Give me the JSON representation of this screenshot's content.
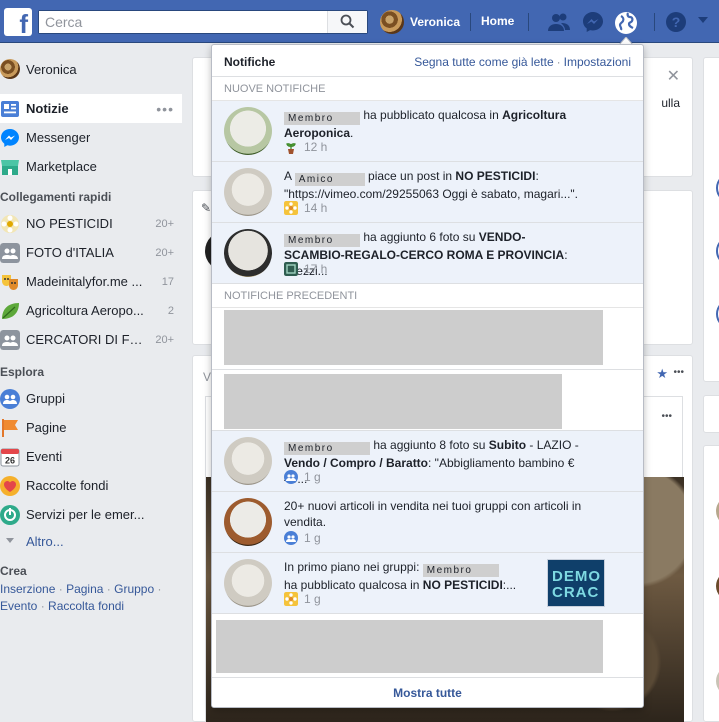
{
  "topbar": {
    "logo": "f",
    "search_placeholder": "Cerca",
    "user_name": "Veronica",
    "home_label": "Home"
  },
  "leftnav": {
    "user": "Veronica",
    "items": [
      {
        "label": "Notizie"
      },
      {
        "label": "Messenger"
      },
      {
        "label": "Marketplace"
      }
    ],
    "shortcuts_header": "Collegamenti rapidi",
    "shortcuts": [
      {
        "label": "NO PESTICIDI",
        "count": "20+"
      },
      {
        "label": "FOTO d'ITALIA",
        "count": "20+"
      },
      {
        "label": "Madeinitalyfor.me ...",
        "count": "17"
      },
      {
        "label": "Agricoltura Aeropo...",
        "count": "2"
      },
      {
        "label": "CERCATORI DI FU...",
        "count": "20+"
      }
    ],
    "explore_header": "Esplora",
    "explore": [
      {
        "label": "Gruppi"
      },
      {
        "label": "Pagine"
      },
      {
        "label": "Eventi"
      },
      {
        "label": "Raccolte fondi"
      },
      {
        "label": "Servizi per le emer..."
      }
    ],
    "more": "Altro...",
    "create_header": "Crea",
    "create_links": [
      "Inserzione",
      "Pagina",
      "Gruppo",
      "Evento",
      "Raccolta fondi"
    ],
    "sep": "·"
  },
  "feed": {
    "partial_text": "ulla",
    "partial_v": "V"
  },
  "notifications": {
    "title": "Notifiche",
    "mark_all": "Segna tutte come già lette",
    "settings": "Impostazioni",
    "new_section": "NUOVE NOTIFICHE",
    "old_section": "NOTIFICHE PRECEDENTI",
    "items": [
      {
        "tag": "Membro",
        "pre": "",
        "text": " ha pubblicato qualcosa in ",
        "strong": "Agricoltura Aeroponica",
        "tail": ".",
        "time": "12 h"
      },
      {
        "tag": "Amico",
        "pre": "A ",
        "text": " piace un post in ",
        "strong": "NO PESTICIDI",
        "tail": ": \"https://vimeo.com/29255063 Oggi è sabato, magari...\".",
        "time": "14 h"
      },
      {
        "tag": "Membro",
        "pre": "",
        "text": " ha aggiunto 6 foto su ",
        "strong": "VENDO-SCAMBIO-REGALO-CERCO ROMA E PROVINCIA",
        "tail": ": \"Pezzi...",
        "time": "17 h"
      },
      {
        "tag": "Membro",
        "pre": "",
        "text": " ha aggiunto 8 foto su ",
        "strong": "Subito",
        "tail": " - LAZIO - ",
        "strong2": "Vendo / Compro / Baratto",
        "tail2": ": \"Abbigliamento bambino € 40...",
        "time": "1 g"
      },
      {
        "text": "20+ nuovi articoli in vendita nei tuoi gruppi con articoli in vendita.",
        "time": "1 g"
      },
      {
        "tag": "Membro",
        "pre": "In primo piano nei gruppi: ",
        "text": "ha pubblicato qualcosa in ",
        "strong": "NO PESTICIDI",
        "tail": ":...",
        "time": "1 g",
        "thumb1": "DEMO",
        "thumb2": "CRAC"
      }
    ],
    "footer": "Mostra tutte"
  }
}
